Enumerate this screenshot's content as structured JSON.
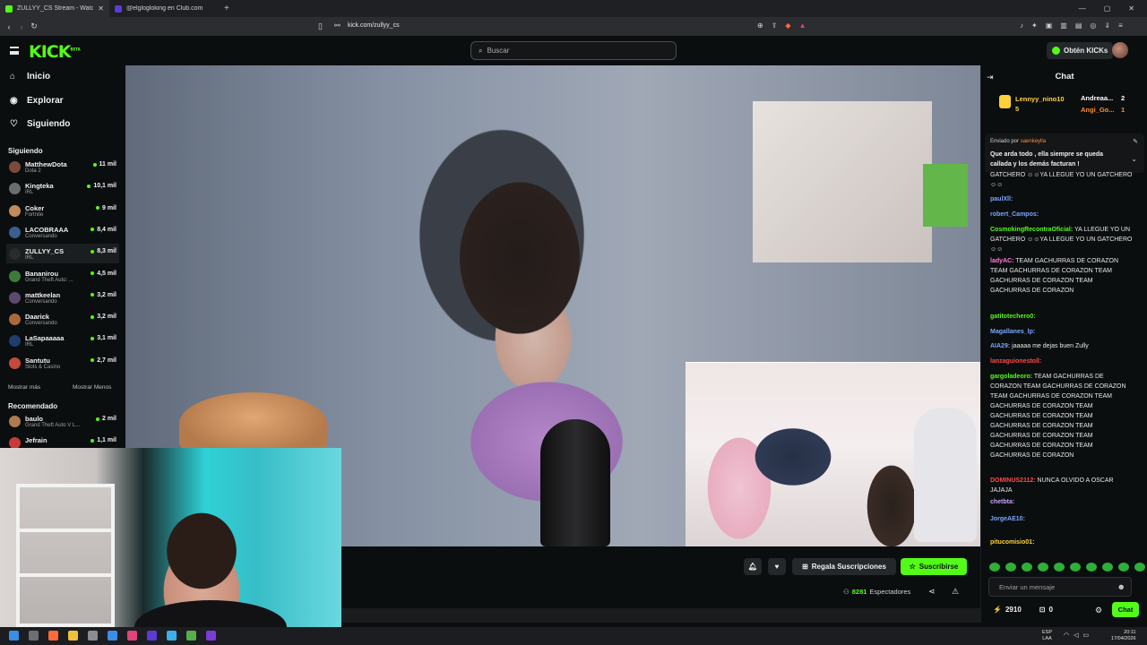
{
  "browser": {
    "tabs": [
      {
        "title": "ZULLYY_CS Stream - Watch Li",
        "active": true
      },
      {
        "title": "@elglogloking en Club.com",
        "active": false
      }
    ],
    "url": "kick.com/zullyy_cs"
  },
  "header": {
    "logo": "KICK",
    "logo_beta": "BETA",
    "search_placeholder": "Buscar",
    "kicks_button": "Obtén KICKs"
  },
  "sidebar": {
    "nav": [
      {
        "label": "Inicio",
        "icon": "home-icon"
      },
      {
        "label": "Explorar",
        "icon": "compass-icon"
      },
      {
        "label": "Siguiendo",
        "icon": "heart-icon"
      }
    ],
    "following_title": "Siguiendo",
    "following": [
      {
        "name": "MatthewDota",
        "category": "Dota 2",
        "viewers": "11 mil",
        "color": "#7a4b3a"
      },
      {
        "name": "Kingteka",
        "category": "IRL",
        "viewers": "10,1 mil",
        "color": "#6c6c6c"
      },
      {
        "name": "Coker",
        "category": "Fortnite",
        "viewers": "9 mil",
        "color": "#c48a5c"
      },
      {
        "name": "LACOBRAAA",
        "category": "Conversando",
        "viewers": "8,4 mil",
        "color": "#3b5d8f"
      },
      {
        "name": "ZULLYY_CS",
        "category": "IRL",
        "viewers": "8,3 mil",
        "color": "#2b2b2b"
      },
      {
        "name": "Bananirou",
        "category": "Grand Theft Auto: ...",
        "viewers": "4,5 mil",
        "color": "#3d7a3c"
      },
      {
        "name": "mattkeelan",
        "category": "Conversando",
        "viewers": "3,2 mil",
        "color": "#5c4a6e"
      },
      {
        "name": "Daarick",
        "category": "Conversando",
        "viewers": "3,2 mil",
        "color": "#a86a3a"
      },
      {
        "name": "LaSapaaaaa",
        "category": "IRL",
        "viewers": "3,1 mil",
        "color": "#1f3d6e"
      },
      {
        "name": "Santutu",
        "category": "Slots & Casino",
        "viewers": "2,7 mil",
        "color": "#c44a3a"
      }
    ],
    "show_more": "Mostrar más",
    "show_less": "Mostrar Menos",
    "recommended_title": "Recomendado",
    "recommended": [
      {
        "name": "baulo",
        "category": "Grand Theft Auto V L...",
        "viewers": "2 mil",
        "color": "#b07a50"
      },
      {
        "name": "Jefrain",
        "category": "",
        "viewers": "1,1 mil",
        "color": "#c83a3a"
      }
    ]
  },
  "stream": {
    "gift_subs": "Regala Suscripciones",
    "subscribe": "Suscribirse",
    "viewers_count": "8281",
    "viewers_label": "Espectadores"
  },
  "chat": {
    "title": "Chat",
    "leaderboard": [
      {
        "name": "Lennyy_nino10",
        "count": "5",
        "color": "#ffd23a"
      },
      {
        "name": "Andreaa...",
        "count": "2",
        "color": "#ffffff"
      },
      {
        "name": "Angi_Go...",
        "count": "1",
        "color": "#ff8c3a"
      }
    ],
    "pinned_by_label": "Enviado por",
    "pinned_by_user": "saenkeylla",
    "pinned_message": "Que arda todo , ella siempre se queda callada y los demás facturan !",
    "messages": [
      {
        "user": "",
        "text": "GATCHERO ☺☺YA LLEGUE YO UN GATCHERO ☺☺",
        "color": "#e6e6e6"
      },
      {
        "user": "paulXll:",
        "text": "",
        "color": "#7aa6ff"
      },
      {
        "user": "robert_Campos:",
        "text": "",
        "color": "#7aa6ff"
      },
      {
        "user": "CosmokingRecontraOficial:",
        "text": "YA LLEGUE YO UN GATCHERO ☺☺YA LLEGUE YO UN GATCHERO ☺☺",
        "color": "#53fc18"
      },
      {
        "user": "ladyAC:",
        "text": "TEAM GACHURRAS DE CORAZON TEAM GACHURRAS DE CORAZON TEAM GACHURRAS DE CORAZON TEAM GACHURRAS DE CORAZON",
        "color": "#ff7ad9"
      },
      {
        "user": "gatitotechero0:",
        "text": "",
        "color": "#53fc18"
      },
      {
        "user": "Magallanes_lp:",
        "text": "",
        "color": "#7aa6ff"
      },
      {
        "user": "AIA29:",
        "text": "jaaaaa me dejas buen Zully",
        "color": "#7aa6ff"
      },
      {
        "user": "lanzaguionestoll:",
        "text": "",
        "color": "#ff4a4a"
      },
      {
        "user": "gargoladeoro:",
        "text": "TEAM GACHURRAS DE CORAZON TEAM GACHURRAS DE CORAZON TEAM GACHURRAS DE CORAZON TEAM GACHURRAS DE CORAZON TEAM GACHURRAS DE CORAZON TEAM GACHURRAS DE CORAZON TEAM GACHURRAS DE CORAZON TEAM GACHURRAS DE CORAZON TEAM GACHURRAS DE CORAZON",
        "color": "#53fc18"
      },
      {
        "user": "DOMINUS2112:",
        "text": "NUNCA OLVIDO A OSCAR JAJAJA",
        "color": "#ff4a4a"
      },
      {
        "user": "chetbta:",
        "text": "",
        "color": "#c8a2ff"
      },
      {
        "user": "JorgeAE10:",
        "text": "",
        "color": "#7aa6ff"
      },
      {
        "user": "pitucomisio01:",
        "text": "",
        "color": "#ffd23a"
      }
    ],
    "input_placeholder": "Enviar un mensaje",
    "points": "2910",
    "other_count": "0",
    "send_label": "Chat"
  },
  "taskbar": {
    "lang_top": "ESP",
    "lang_bottom": "LAA",
    "time": "20:11",
    "date": "17/04/2026"
  }
}
